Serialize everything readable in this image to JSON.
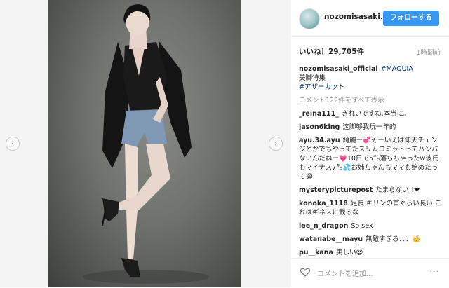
{
  "post": {
    "username": "nozomisasaki...",
    "follow_label": "フォローする",
    "likes": "いいね！29,705件",
    "time": "1時間前"
  },
  "caption": {
    "username": "nozomisasaki_official",
    "tag": "#MAQUIA",
    "line2": "美脚特集",
    "line3": "#アザーカット"
  },
  "view_all": "コメント122件をすべて表示",
  "comments": [
    {
      "user": "_reina111_",
      "text": "きれいですね,本当に。"
    },
    {
      "user": "jason6king",
      "text": "这脚够我玩一年的"
    },
    {
      "user": "ayu.34.ayu",
      "text": "綺麗ー💞そーいえば仰天チェンジとかでもやってたスリムコミットってハンパないんだねー💗10日で5㌔落ちちゃったw彼氏もマイナス7㌔💦お姉ちゃんもママも始めたって😂"
    },
    {
      "user": "mysterypicturepost",
      "text": "たまらない!!❤"
    },
    {
      "user": "konoka_1118",
      "text": "足長 キリンの首ぐらい長い これはギネスに載るな"
    },
    {
      "user": "lee_n_dragon",
      "text": "So sex"
    },
    {
      "user": "watanabe__mayu",
      "text": "無敵すぎる、、、👑"
    },
    {
      "user": "pu__kana",
      "text": "美しい😍"
    }
  ],
  "add_comment_placeholder": "コメントを追加...",
  "more": "···",
  "icons": {
    "heart": "heart-icon",
    "prev": "chevron-left-icon",
    "next": "chevron-right-icon"
  },
  "nav": {
    "prev": "‹",
    "next": "›"
  },
  "colors": {
    "follow": "#3897f0",
    "tag": "#003569",
    "muted": "#999999"
  }
}
